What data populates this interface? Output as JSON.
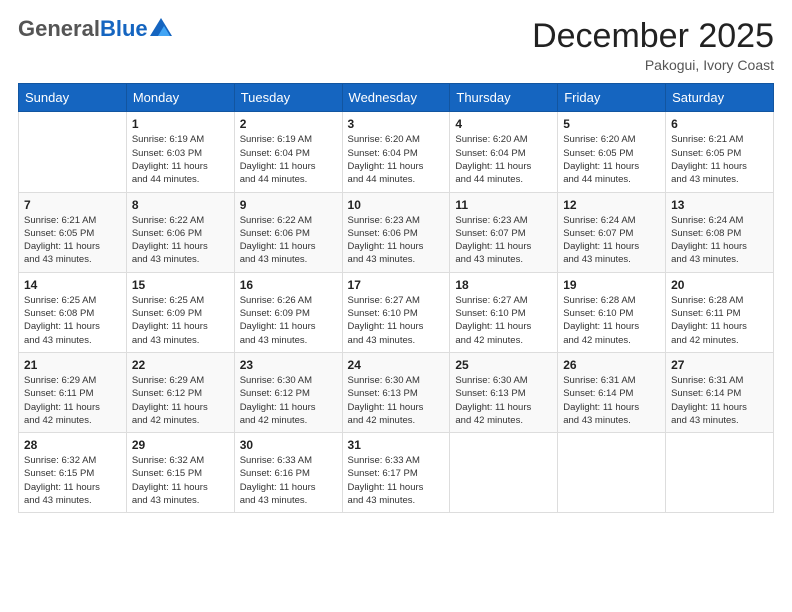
{
  "logo": {
    "general": "General",
    "blue": "Blue"
  },
  "header": {
    "month": "December 2025",
    "location": "Pakogui, Ivory Coast"
  },
  "weekdays": [
    "Sunday",
    "Monday",
    "Tuesday",
    "Wednesday",
    "Thursday",
    "Friday",
    "Saturday"
  ],
  "weeks": [
    [
      {
        "day": "",
        "info": ""
      },
      {
        "day": "1",
        "info": "Sunrise: 6:19 AM\nSunset: 6:03 PM\nDaylight: 11 hours\nand 44 minutes."
      },
      {
        "day": "2",
        "info": "Sunrise: 6:19 AM\nSunset: 6:04 PM\nDaylight: 11 hours\nand 44 minutes."
      },
      {
        "day": "3",
        "info": "Sunrise: 6:20 AM\nSunset: 6:04 PM\nDaylight: 11 hours\nand 44 minutes."
      },
      {
        "day": "4",
        "info": "Sunrise: 6:20 AM\nSunset: 6:04 PM\nDaylight: 11 hours\nand 44 minutes."
      },
      {
        "day": "5",
        "info": "Sunrise: 6:20 AM\nSunset: 6:05 PM\nDaylight: 11 hours\nand 44 minutes."
      },
      {
        "day": "6",
        "info": "Sunrise: 6:21 AM\nSunset: 6:05 PM\nDaylight: 11 hours\nand 43 minutes."
      }
    ],
    [
      {
        "day": "7",
        "info": "Sunrise: 6:21 AM\nSunset: 6:05 PM\nDaylight: 11 hours\nand 43 minutes."
      },
      {
        "day": "8",
        "info": "Sunrise: 6:22 AM\nSunset: 6:06 PM\nDaylight: 11 hours\nand 43 minutes."
      },
      {
        "day": "9",
        "info": "Sunrise: 6:22 AM\nSunset: 6:06 PM\nDaylight: 11 hours\nand 43 minutes."
      },
      {
        "day": "10",
        "info": "Sunrise: 6:23 AM\nSunset: 6:06 PM\nDaylight: 11 hours\nand 43 minutes."
      },
      {
        "day": "11",
        "info": "Sunrise: 6:23 AM\nSunset: 6:07 PM\nDaylight: 11 hours\nand 43 minutes."
      },
      {
        "day": "12",
        "info": "Sunrise: 6:24 AM\nSunset: 6:07 PM\nDaylight: 11 hours\nand 43 minutes."
      },
      {
        "day": "13",
        "info": "Sunrise: 6:24 AM\nSunset: 6:08 PM\nDaylight: 11 hours\nand 43 minutes."
      }
    ],
    [
      {
        "day": "14",
        "info": "Sunrise: 6:25 AM\nSunset: 6:08 PM\nDaylight: 11 hours\nand 43 minutes."
      },
      {
        "day": "15",
        "info": "Sunrise: 6:25 AM\nSunset: 6:09 PM\nDaylight: 11 hours\nand 43 minutes."
      },
      {
        "day": "16",
        "info": "Sunrise: 6:26 AM\nSunset: 6:09 PM\nDaylight: 11 hours\nand 43 minutes."
      },
      {
        "day": "17",
        "info": "Sunrise: 6:27 AM\nSunset: 6:10 PM\nDaylight: 11 hours\nand 43 minutes."
      },
      {
        "day": "18",
        "info": "Sunrise: 6:27 AM\nSunset: 6:10 PM\nDaylight: 11 hours\nand 42 minutes."
      },
      {
        "day": "19",
        "info": "Sunrise: 6:28 AM\nSunset: 6:10 PM\nDaylight: 11 hours\nand 42 minutes."
      },
      {
        "day": "20",
        "info": "Sunrise: 6:28 AM\nSunset: 6:11 PM\nDaylight: 11 hours\nand 42 minutes."
      }
    ],
    [
      {
        "day": "21",
        "info": "Sunrise: 6:29 AM\nSunset: 6:11 PM\nDaylight: 11 hours\nand 42 minutes."
      },
      {
        "day": "22",
        "info": "Sunrise: 6:29 AM\nSunset: 6:12 PM\nDaylight: 11 hours\nand 42 minutes."
      },
      {
        "day": "23",
        "info": "Sunrise: 6:30 AM\nSunset: 6:12 PM\nDaylight: 11 hours\nand 42 minutes."
      },
      {
        "day": "24",
        "info": "Sunrise: 6:30 AM\nSunset: 6:13 PM\nDaylight: 11 hours\nand 42 minutes."
      },
      {
        "day": "25",
        "info": "Sunrise: 6:30 AM\nSunset: 6:13 PM\nDaylight: 11 hours\nand 42 minutes."
      },
      {
        "day": "26",
        "info": "Sunrise: 6:31 AM\nSunset: 6:14 PM\nDaylight: 11 hours\nand 43 minutes."
      },
      {
        "day": "27",
        "info": "Sunrise: 6:31 AM\nSunset: 6:14 PM\nDaylight: 11 hours\nand 43 minutes."
      }
    ],
    [
      {
        "day": "28",
        "info": "Sunrise: 6:32 AM\nSunset: 6:15 PM\nDaylight: 11 hours\nand 43 minutes."
      },
      {
        "day": "29",
        "info": "Sunrise: 6:32 AM\nSunset: 6:15 PM\nDaylight: 11 hours\nand 43 minutes."
      },
      {
        "day": "30",
        "info": "Sunrise: 6:33 AM\nSunset: 6:16 PM\nDaylight: 11 hours\nand 43 minutes."
      },
      {
        "day": "31",
        "info": "Sunrise: 6:33 AM\nSunset: 6:17 PM\nDaylight: 11 hours\nand 43 minutes."
      },
      {
        "day": "",
        "info": ""
      },
      {
        "day": "",
        "info": ""
      },
      {
        "day": "",
        "info": ""
      }
    ]
  ]
}
